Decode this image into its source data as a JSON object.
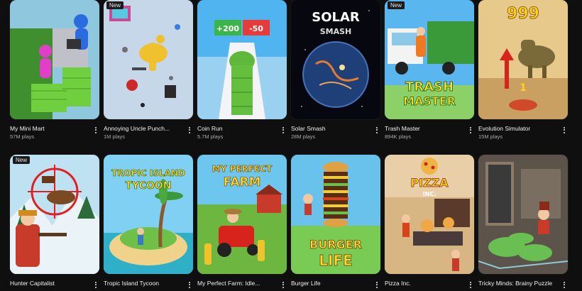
{
  "more_icon": "more-vert-icon",
  "games": [
    {
      "title": "My Mini Mart",
      "plays": "57M plays",
      "badge": ""
    },
    {
      "title": "Annoying Uncle Punch...",
      "plays": "1M plays",
      "badge": "New"
    },
    {
      "title": "Coin Run",
      "plays": "5.7M plays",
      "badge": "",
      "thumb_text": [
        "+200",
        "-50"
      ]
    },
    {
      "title": "Solar Smash",
      "plays": "28M plays",
      "badge": "",
      "thumb_text": [
        "SOLAR",
        "SMASH"
      ]
    },
    {
      "title": "Trash Master",
      "plays": "894K plays",
      "badge": "New",
      "thumb_text": [
        "TRASH",
        "MASTER"
      ]
    },
    {
      "title": "Evolution Simulator",
      "plays": "15M plays",
      "badge": "",
      "thumb_text": [
        "999",
        "1"
      ]
    },
    {
      "title": "Hunter Capitalist",
      "plays": "",
      "badge": "New"
    },
    {
      "title": "Tropic Island Tycoon",
      "plays": "",
      "badge": "",
      "thumb_text": [
        "TROPIC ISLAND",
        "TYCOON"
      ]
    },
    {
      "title": "My Perfect Farm: Idle...",
      "plays": "",
      "badge": "",
      "thumb_text": [
        "MY PERFECT",
        "FARM"
      ]
    },
    {
      "title": "Burger Life",
      "plays": "",
      "badge": "",
      "thumb_text": [
        "BURGER",
        "LIFE"
      ]
    },
    {
      "title": "Pizza Inc.",
      "plays": "",
      "badge": "",
      "thumb_text": [
        "PIZZA",
        "INC."
      ]
    },
    {
      "title": "Tricky Minds: Brainy Puzzle",
      "plays": "",
      "badge": ""
    }
  ],
  "colors": {
    "background": "#0f0f0f",
    "title_text": "#f1f1f1",
    "meta_text": "#aaaaaa"
  }
}
